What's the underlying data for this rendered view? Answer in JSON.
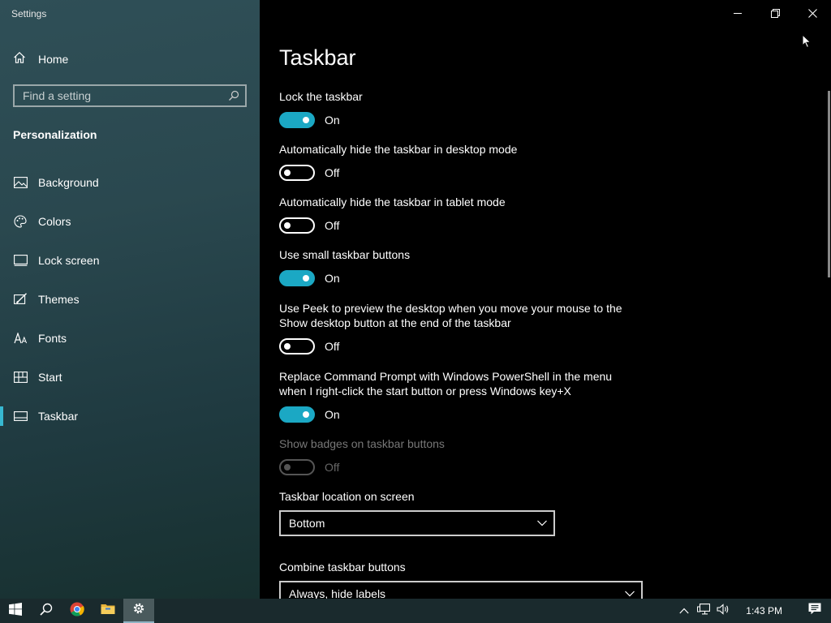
{
  "window": {
    "title": "Settings"
  },
  "sidebar": {
    "home_label": "Home",
    "search_placeholder": "Find a setting",
    "section_title": "Personalization",
    "items": [
      {
        "label": "Background",
        "icon": "picture-icon"
      },
      {
        "label": "Colors",
        "icon": "palette-icon"
      },
      {
        "label": "Lock screen",
        "icon": "lock-screen-icon"
      },
      {
        "label": "Themes",
        "icon": "brush-icon"
      },
      {
        "label": "Fonts",
        "icon": "font-icon"
      },
      {
        "label": "Start",
        "icon": "start-tiles-icon"
      },
      {
        "label": "Taskbar",
        "icon": "taskbar-icon",
        "selected": true
      }
    ]
  },
  "main": {
    "page_title": "Taskbar",
    "settings": [
      {
        "label": "Lock the taskbar",
        "state": "On",
        "on": true
      },
      {
        "label": "Automatically hide the taskbar in desktop mode",
        "state": "Off",
        "on": false
      },
      {
        "label": "Automatically hide the taskbar in tablet mode",
        "state": "Off",
        "on": false
      },
      {
        "label": "Use small taskbar buttons",
        "state": "On",
        "on": true
      },
      {
        "label": "Use Peek to preview the desktop when you move your mouse to the Show desktop button at the end of the taskbar",
        "state": "Off",
        "on": false
      },
      {
        "label": "Replace Command Prompt with Windows PowerShell in the menu when I right-click the start button or press Windows key+X",
        "state": "On",
        "on": true
      },
      {
        "label": "Show badges on taskbar buttons",
        "state": "Off",
        "on": false,
        "disabled": true
      }
    ],
    "location_label": "Taskbar location on screen",
    "location_value": "Bottom",
    "combine_label": "Combine taskbar buttons",
    "combine_value": "Always, hide labels"
  },
  "taskbar": {
    "clock": "1:43 PM",
    "apps": [
      "windows-start-icon",
      "search-icon",
      "chrome-icon",
      "file-explorer-icon",
      "settings-gear-icon"
    ]
  },
  "colors": {
    "accent": "#1ba8c4",
    "selection_bar": "#37b8d1"
  }
}
